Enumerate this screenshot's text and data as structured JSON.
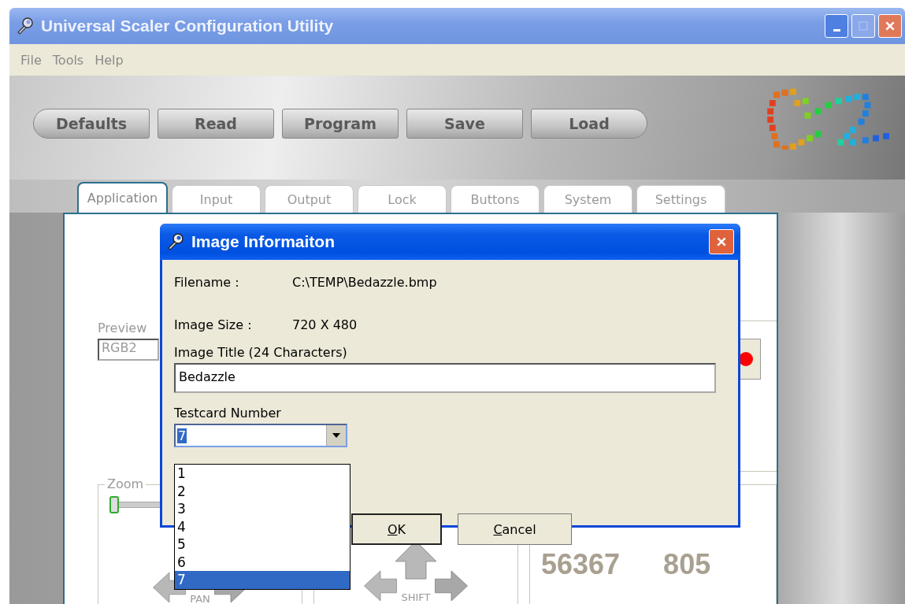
{
  "window": {
    "title": "Universal Scaler Configuration Utility"
  },
  "menu": [
    "File",
    "Tools",
    "Help"
  ],
  "toolbar": [
    "Defaults",
    "Read",
    "Program",
    "Save",
    "Load"
  ],
  "tabs": [
    {
      "label": "Application",
      "selected": true
    },
    {
      "label": "Input",
      "selected": false
    },
    {
      "label": "Output",
      "selected": false
    },
    {
      "label": "Lock",
      "selected": false
    },
    {
      "label": "Buttons",
      "selected": false
    },
    {
      "label": "System",
      "selected": false
    },
    {
      "label": "Settings",
      "selected": false
    }
  ],
  "panel": {
    "preview_label": "Preview",
    "preview_value": "RGB2",
    "zoom_label": "Zoom",
    "zoom": {
      "level": 0
    },
    "pan_label": "PAN",
    "shift_label": "SHIFT",
    "readings": [
      "56367",
      "805"
    ]
  },
  "dialog": {
    "title": "Image Informaiton",
    "fields": [
      {
        "label": "Filename :",
        "value": "C:\\TEMP\\Bedazzle.bmp"
      },
      {
        "label": "Image Size :",
        "value": "720 X 480"
      }
    ],
    "image_title": {
      "label": "Image Title (24 Characters)",
      "value": "Bedazzle"
    },
    "testcard": {
      "label": "Testcard Number",
      "value": "7",
      "expanded": true,
      "options": [
        {
          "label": "1",
          "selected": false
        },
        {
          "label": "2",
          "selected": false
        },
        {
          "label": "3",
          "selected": false
        },
        {
          "label": "4",
          "selected": false
        },
        {
          "label": "5",
          "selected": false
        },
        {
          "label": "6",
          "selected": false
        },
        {
          "label": "7",
          "selected": true
        }
      ]
    },
    "buttons": [
      "OK",
      "Cancel"
    ]
  }
}
